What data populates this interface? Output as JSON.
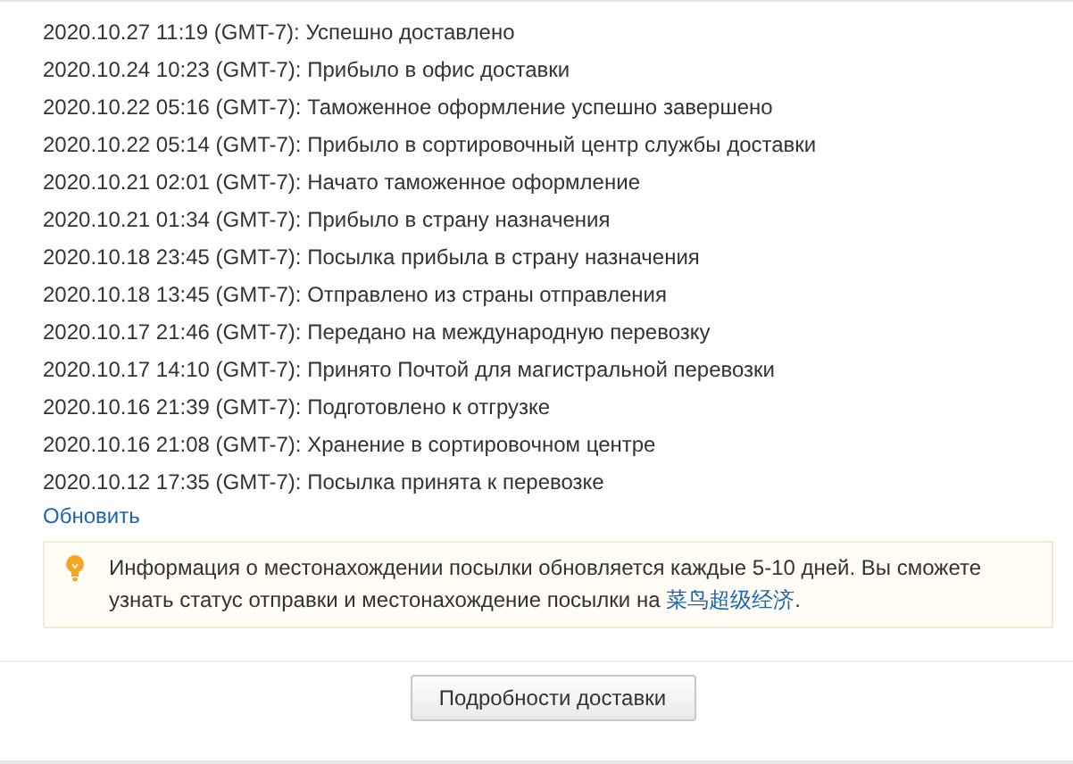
{
  "events": [
    {
      "time": "2020.10.27 11:19 (GMT-7):",
      "status": "Успешно доставлено"
    },
    {
      "time": "2020.10.24 10:23 (GMT-7):",
      "status": "Прибыло в офис доставки"
    },
    {
      "time": "2020.10.22 05:16 (GMT-7):",
      "status": "Таможенное оформление успешно завершено"
    },
    {
      "time": "2020.10.22 05:14 (GMT-7):",
      "status": "Прибыло в сортировочный центр службы доставки"
    },
    {
      "time": "2020.10.21 02:01 (GMT-7):",
      "status": "Начато таможенное оформление"
    },
    {
      "time": "2020.10.21 01:34 (GMT-7):",
      "status": "Прибыло в страну назначения"
    },
    {
      "time": "2020.10.18 23:45 (GMT-7):",
      "status": "Посылка прибыла в страну назначения"
    },
    {
      "time": "2020.10.18 13:45 (GMT-7):",
      "status": "Отправлено из страны отправления"
    },
    {
      "time": "2020.10.17 21:46 (GMT-7):",
      "status": "Передано на международную перевозку"
    },
    {
      "time": "2020.10.17 14:10 (GMT-7):",
      "status": "Принято Почтой для магистральной перевозки"
    },
    {
      "time": "2020.10.16 21:39 (GMT-7):",
      "status": "Подготовлено к отгрузке"
    },
    {
      "time": "2020.10.16 21:08 (GMT-7):",
      "status": "Хранение в сортировочном центре"
    },
    {
      "time": "2020.10.12 17:35 (GMT-7):",
      "status": "Посылка принята к перевозке"
    }
  ],
  "refresh_link": "Обновить",
  "notice": {
    "text": "Информация о местонахождении посылки обновляется каждые 5-10 дней. Вы сможете узнать статус отправки и местонахождение посылки на ",
    "link": "菜鸟超级经济",
    "after": "."
  },
  "details_button": "Подробности доставки"
}
